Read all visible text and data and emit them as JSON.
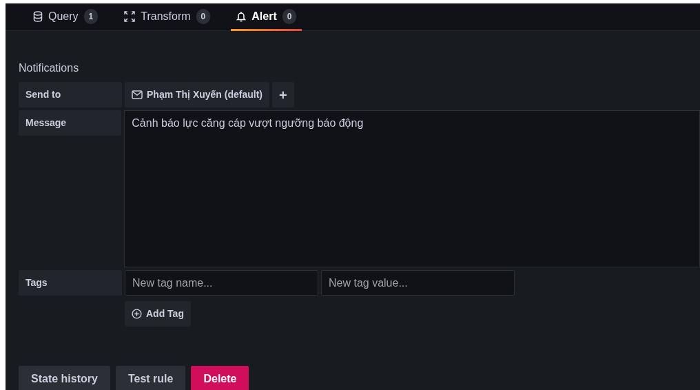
{
  "tabs": [
    {
      "label": "Query",
      "count": "1",
      "kind": "query",
      "selected": false
    },
    {
      "label": "Transform",
      "count": "0",
      "kind": "transform",
      "selected": false
    },
    {
      "label": "Alert",
      "count": "0",
      "kind": "alert",
      "selected": true
    }
  ],
  "notifications": {
    "title": "Notifications",
    "send_to": {
      "label": "Send to",
      "recipient": "Phạm Thị Xuyến (default)",
      "add": "+"
    },
    "message": {
      "label": "Message",
      "value": "Cảnh báo lực căng cáp vượt ngưỡng báo động"
    },
    "tags": {
      "label": "Tags",
      "name_placeholder": "New tag name...",
      "value_placeholder": "New tag value...",
      "add": "Add Tag"
    }
  },
  "buttons": [
    {
      "label": "State history",
      "kind": "secondary"
    },
    {
      "label": "Test rule",
      "kind": "secondary"
    },
    {
      "label": "Delete",
      "kind": "destructive"
    }
  ]
}
